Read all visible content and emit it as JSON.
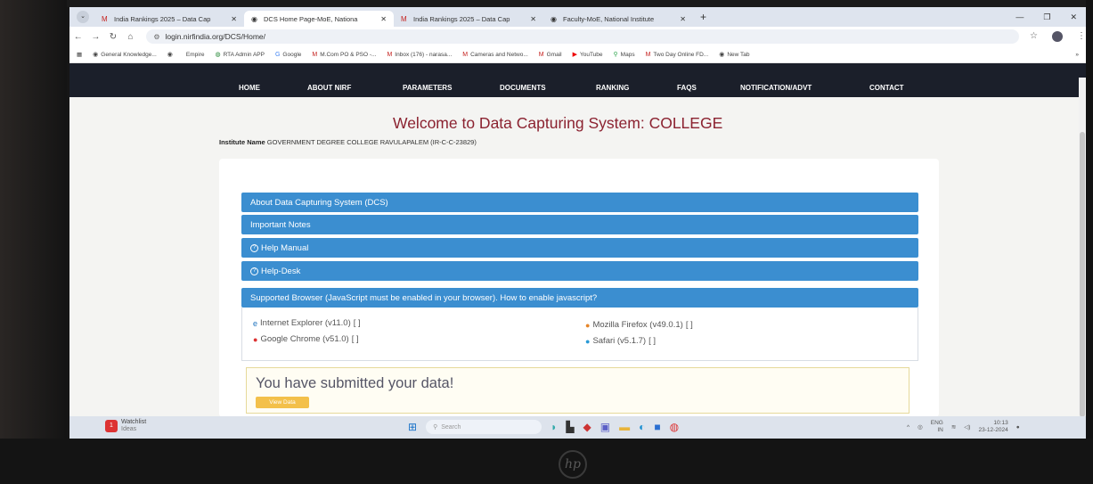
{
  "browser": {
    "tabs": [
      {
        "label": "India Rankings 2025 – Data Cap",
        "icon": "gmail-icon",
        "active": false
      },
      {
        "label": "DCS Home Page-MoE, Nationa",
        "icon": "globe-icon",
        "active": true
      },
      {
        "label": "India Rankings 2025 – Data Cap",
        "icon": "gmail-icon",
        "active": false
      },
      {
        "label": "Faculty-MoE, National Institute",
        "icon": "globe-icon",
        "active": false
      }
    ],
    "url": "login.nirfindia.org/DCS/Home/",
    "bookmarks": [
      "General Knowledge...",
      "",
      "Empire",
      "RTA Admin APP",
      "Google",
      "M.Com PO & PSO -...",
      "Inbox (176) - narasa...",
      "Cameras and Netwo...",
      "Gmail",
      "YouTube",
      "Maps",
      "Two Day Online FD...",
      "New Tab"
    ]
  },
  "nav": {
    "items": [
      "HOME",
      "ABOUT NIRF",
      "PARAMETERS",
      "DOCUMENTS",
      "RANKING",
      "FAQS",
      "NOTIFICATION/ADVT",
      "CONTACT"
    ]
  },
  "page": {
    "title": "Welcome to Data Capturing System: COLLEGE",
    "institute_label": "Institute Name",
    "institute_value": "GOVERNMENT DEGREE COLLEGE RAVULAPALEM (IR-C-C-23829)",
    "sections": [
      "About Data Capturing System (DCS)",
      "Important Notes",
      "Help Manual",
      "Help-Desk",
      "Supported Browser (JavaScript must be enabled in your browser). How to enable javascript?"
    ],
    "browsers": [
      {
        "name": "Internet Explorer (v11.0)",
        "link": "[  ]"
      },
      {
        "name": "Mozilla Firefox (v49.0.1)",
        "link": "[  ]"
      },
      {
        "name": "Google Chrome (v51.0)",
        "link": "[  ]"
      },
      {
        "name": "Safari (v5.1.7)",
        "link": "[  ]"
      }
    ],
    "submitted_msg": "You have submitted your data!",
    "view_button": "View Data"
  },
  "taskbar": {
    "widget_label": "Watchlist",
    "widget_sub": "Ideas",
    "search_placeholder": "Search",
    "lang": "ENG",
    "region": "IN",
    "time": "10:13",
    "date": "23-12-2024"
  }
}
